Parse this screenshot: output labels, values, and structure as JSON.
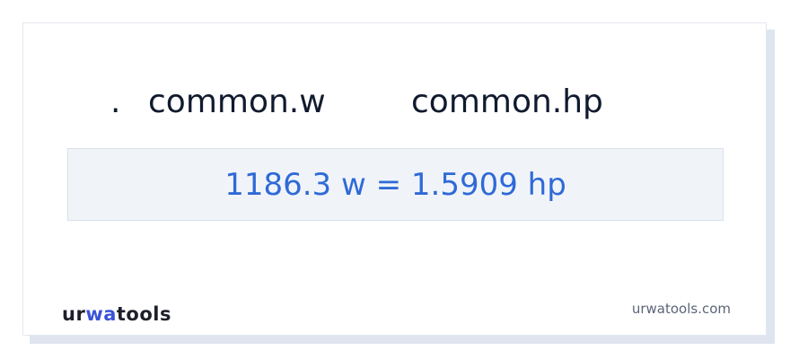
{
  "units": {
    "dot": ".",
    "from": "common.w",
    "to": "common.hp"
  },
  "result": {
    "text": "1186.3 w = 1.5909 hp"
  },
  "footer": {
    "logo_part1": "ur",
    "logo_accent": "wa",
    "logo_part2": "tools",
    "site": "urwatools.com"
  },
  "colors": {
    "result_text": "#2f6ad6",
    "result_background": "#f0f4f9",
    "logo_accent": "#3b54d6"
  }
}
